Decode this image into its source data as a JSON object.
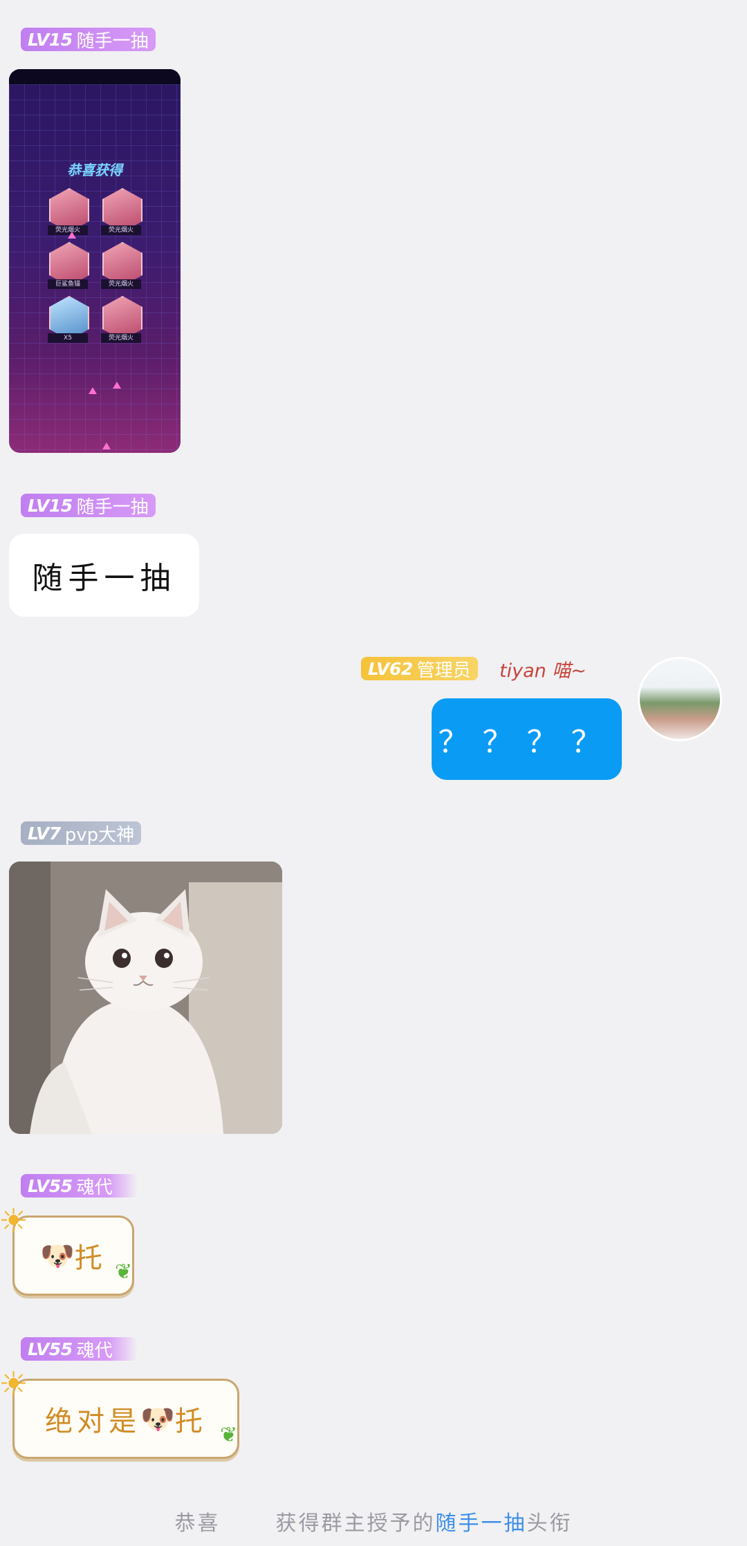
{
  "messages": [
    {
      "id": "m1",
      "sender": {
        "level": "LV15",
        "title": "随手一抽"
      },
      "type": "image",
      "image": {
        "description_title": "恭喜获得",
        "items": [
          {
            "label": "荧光烟火",
            "icon": "pink-hex"
          },
          {
            "label": "荧光烟火",
            "icon": "pink-hex"
          },
          {
            "label": "巨鲨鱼锚",
            "icon": "pink-hex"
          },
          {
            "label": "荧光烟火",
            "icon": "pink-hex"
          },
          {
            "label": "X5",
            "icon": "blue-hex"
          },
          {
            "label": "荧光烟火",
            "icon": "pink-hex"
          }
        ]
      }
    },
    {
      "id": "m2",
      "sender": {
        "level": "LV15",
        "title": "随手一抽"
      },
      "type": "text",
      "text": "随手一抽"
    },
    {
      "id": "m3",
      "sender": {
        "level": "LV62",
        "title": "管理员",
        "name": "tiyan 喵~"
      },
      "type": "text",
      "side": "right",
      "text": "？？？？"
    },
    {
      "id": "m4",
      "sender": {
        "level": "LV7",
        "title": "pvp大神"
      },
      "type": "image",
      "image": {
        "subject": "white-cat"
      }
    },
    {
      "id": "m5",
      "sender": {
        "level": "LV55",
        "title": "魂代"
      },
      "type": "sticker-text",
      "emoji": "🐶",
      "text": "托"
    },
    {
      "id": "m6",
      "sender": {
        "level": "LV55",
        "title": "魂代"
      },
      "type": "sticker-text",
      "text_before": "绝对是",
      "emoji": "🐶",
      "text": "托"
    }
  ],
  "system_notice": {
    "prefix": "恭喜",
    "middle": "获得群主授予的",
    "title": "随手一抽",
    "suffix": "头衔"
  },
  "colors": {
    "background": "#f1f1f3",
    "bubble_blue": "#0a9bf5",
    "badge_purple": "#c07ef0",
    "badge_gold": "#f6c23a",
    "badge_gray": "#a6afc3",
    "highlight_blue": "#3c8ee8"
  }
}
